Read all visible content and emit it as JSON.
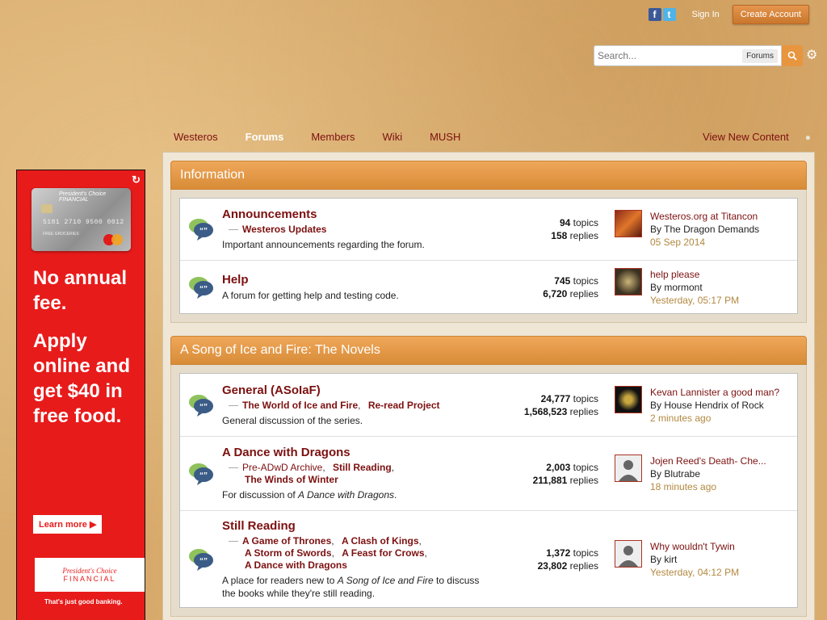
{
  "userbar": {
    "sign_in": "Sign In",
    "create_account": "Create Account"
  },
  "search": {
    "placeholder": "Search...",
    "scope": "Forums"
  },
  "nav": {
    "items": [
      {
        "label": "Westeros"
      },
      {
        "label": "Forums"
      },
      {
        "label": "Members"
      },
      {
        "label": "Wiki"
      },
      {
        "label": "MUSH"
      }
    ],
    "view_new": "View New Content"
  },
  "ad": {
    "card_brand": "President's Choice FINANCIAL",
    "card_number": "5181 2710 9500 0012",
    "card_name": "FREE GROCERIES",
    "headline_1": "No annual fee.",
    "headline_2": "Apply online and get $40 in free food.",
    "learn_more": "Learn more",
    "logo_line1": "President's Choice",
    "logo_line2": "FINANCIAL",
    "tagline": "That's just good banking."
  },
  "categories": [
    {
      "title": "Information",
      "forums": [
        {
          "title": "Announcements",
          "subforums": [
            "Westeros Updates"
          ],
          "description": "Important announcements regarding the forum.",
          "topics": "94",
          "replies": "158",
          "last_title": "Westeros.org at Titancon",
          "last_by": "By The Dragon Demands",
          "last_date": "05 Sep 2014"
        },
        {
          "title": "Help",
          "description": "A forum for getting help and testing code.",
          "topics": "745",
          "replies": "6,720",
          "last_title": "help please",
          "last_by": "By mormont",
          "last_date": "Yesterday, 05:17 PM"
        }
      ]
    },
    {
      "title": "A Song of Ice and Fire: The Novels",
      "forums": [
        {
          "title": "General (ASoIaF)",
          "subforums": [
            "The World of Ice and Fire",
            "Re-read Project"
          ],
          "description": "General discussion of the series.",
          "topics": "24,777",
          "replies": "1,568,523",
          "last_title": "Kevan Lannister a good man?",
          "last_by": "By House Hendrix of Rock",
          "last_date": "2 minutes ago"
        },
        {
          "title": "A Dance with Dragons",
          "subforums": [
            "Pre-ADwD Archive",
            "Still Reading",
            "The Winds of Winter"
          ],
          "description_pre": "For discussion of ",
          "description_em": "A Dance with Dragons",
          "description_post": ".",
          "topics": "2,003",
          "replies": "211,881",
          "last_title": "Jojen Reed's Death- Che...",
          "last_by": "By Blutrabe",
          "last_date": "18 minutes ago"
        },
        {
          "title": "Still Reading",
          "subforums": [
            "A Game of Thrones",
            "A Clash of Kings",
            "A Storm of Swords",
            "A Feast for Crows",
            "A Dance with Dragons"
          ],
          "description_pre": "A place for readers new to ",
          "description_em": "A Song of Ice and Fire",
          "description_post": " to discuss the books while they're still reading.",
          "topics": "1,372",
          "replies": "23,802",
          "last_title": "Why wouldn't Tywin",
          "last_by": "By kirt",
          "last_date": "Yesterday, 04:12 PM"
        }
      ]
    }
  ],
  "labels": {
    "topics": "topics",
    "replies": "replies"
  },
  "colors": {
    "link": "#7c1010",
    "accent": "#e8953f",
    "ad_red": "#e81b1b",
    "date": "#b28940"
  }
}
